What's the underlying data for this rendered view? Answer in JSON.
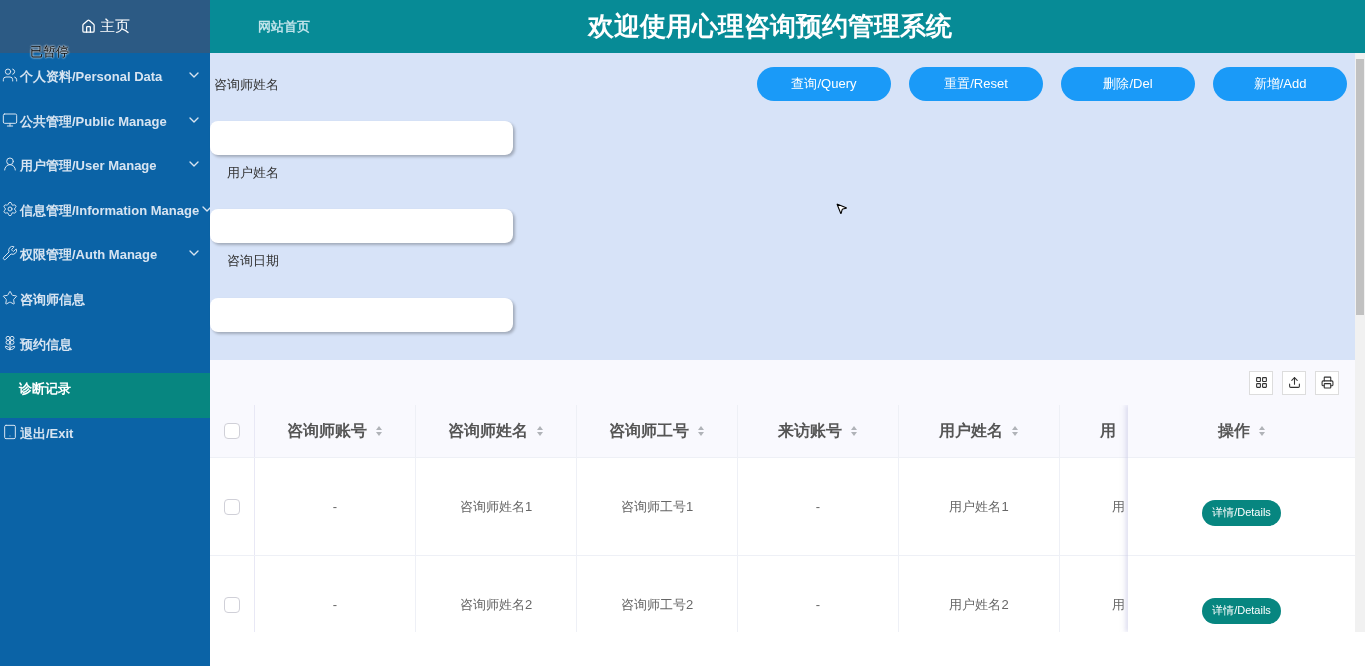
{
  "sidebar": {
    "home": "主页",
    "paused_label": "已暂停",
    "items": [
      {
        "label": "个人资料/Personal Data",
        "kind": "group",
        "selected": false
      },
      {
        "label": "公共管理/Public Manage",
        "kind": "group",
        "selected": false
      },
      {
        "label": "用户管理/User Manage",
        "kind": "group",
        "selected": false
      },
      {
        "label": "信息管理/Information Manage",
        "kind": "group",
        "selected": false
      },
      {
        "label": "权限管理/Auth Manage",
        "kind": "group",
        "selected": false
      },
      {
        "label": "咨询师信息",
        "kind": "link",
        "selected": false
      },
      {
        "label": "预约信息",
        "kind": "link",
        "selected": false
      },
      {
        "label": "诊断记录",
        "kind": "link",
        "selected": true
      },
      {
        "label": "退出/Exit",
        "kind": "link",
        "selected": false
      }
    ]
  },
  "topbar": {
    "home_link": "网站首页",
    "title": "欢迎使用心理咨询预约管理系统"
  },
  "search": {
    "fields": [
      {
        "label": "咨询师姓名"
      },
      {
        "label": "用户姓名"
      },
      {
        "label": "咨询日期"
      }
    ],
    "buttons": [
      "查询/Query",
      "重置/Reset",
      "删除/Del",
      "新增/Add"
    ]
  },
  "table": {
    "all_checked": false,
    "columns": [
      "咨询师账号",
      "咨询师姓名",
      "咨询师工号",
      "来访账号",
      "用户姓名",
      "用"
    ],
    "action_column": "操作",
    "rows": [
      {
        "checked": false,
        "cells": [
          "-",
          "咨询师姓名1",
          "咨询师工号1",
          "-",
          "用户姓名1",
          "用"
        ],
        "action": "详情/Details"
      },
      {
        "checked": false,
        "cells": [
          "-",
          "咨询师姓名2",
          "咨询师工号2",
          "-",
          "用户姓名2",
          "用"
        ],
        "action": "详情/Details"
      }
    ]
  }
}
